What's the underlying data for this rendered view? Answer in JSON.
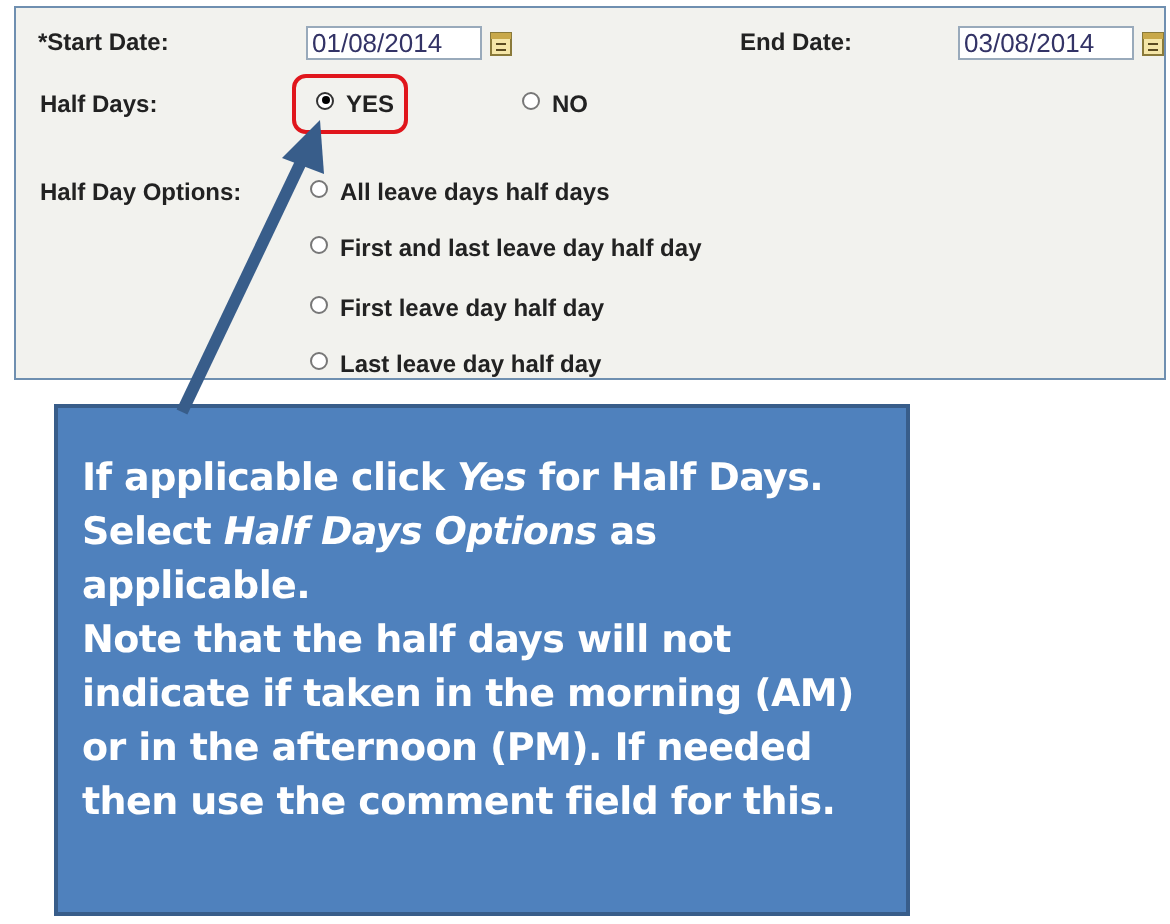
{
  "form": {
    "start_date": {
      "label": "*Start Date:",
      "value": "01/08/2014"
    },
    "end_date": {
      "label": "End Date:",
      "value": "03/08/2014"
    },
    "half_days": {
      "label": "Half Days:",
      "options": [
        {
          "label": "YES",
          "selected": true,
          "highlighted": true
        },
        {
          "label": "NO",
          "selected": false,
          "highlighted": false
        }
      ]
    },
    "half_day_options": {
      "label": "Half Day Options:",
      "options": [
        {
          "label": "All leave days half days",
          "selected": false
        },
        {
          "label": "First and last leave day half day",
          "selected": false
        },
        {
          "label": "First leave day half day",
          "selected": false
        },
        {
          "label": "Last leave day half day",
          "selected": false
        }
      ]
    }
  },
  "callout": {
    "paragraphs": [
      "If applicable click *Yes* for Half Days.",
      "Select *Half Days Options* as applicable.",
      "Note that the half days will not indicate if taken in the morning (AM) or in the afternoon (PM). If needed then use the comment field for this."
    ]
  }
}
